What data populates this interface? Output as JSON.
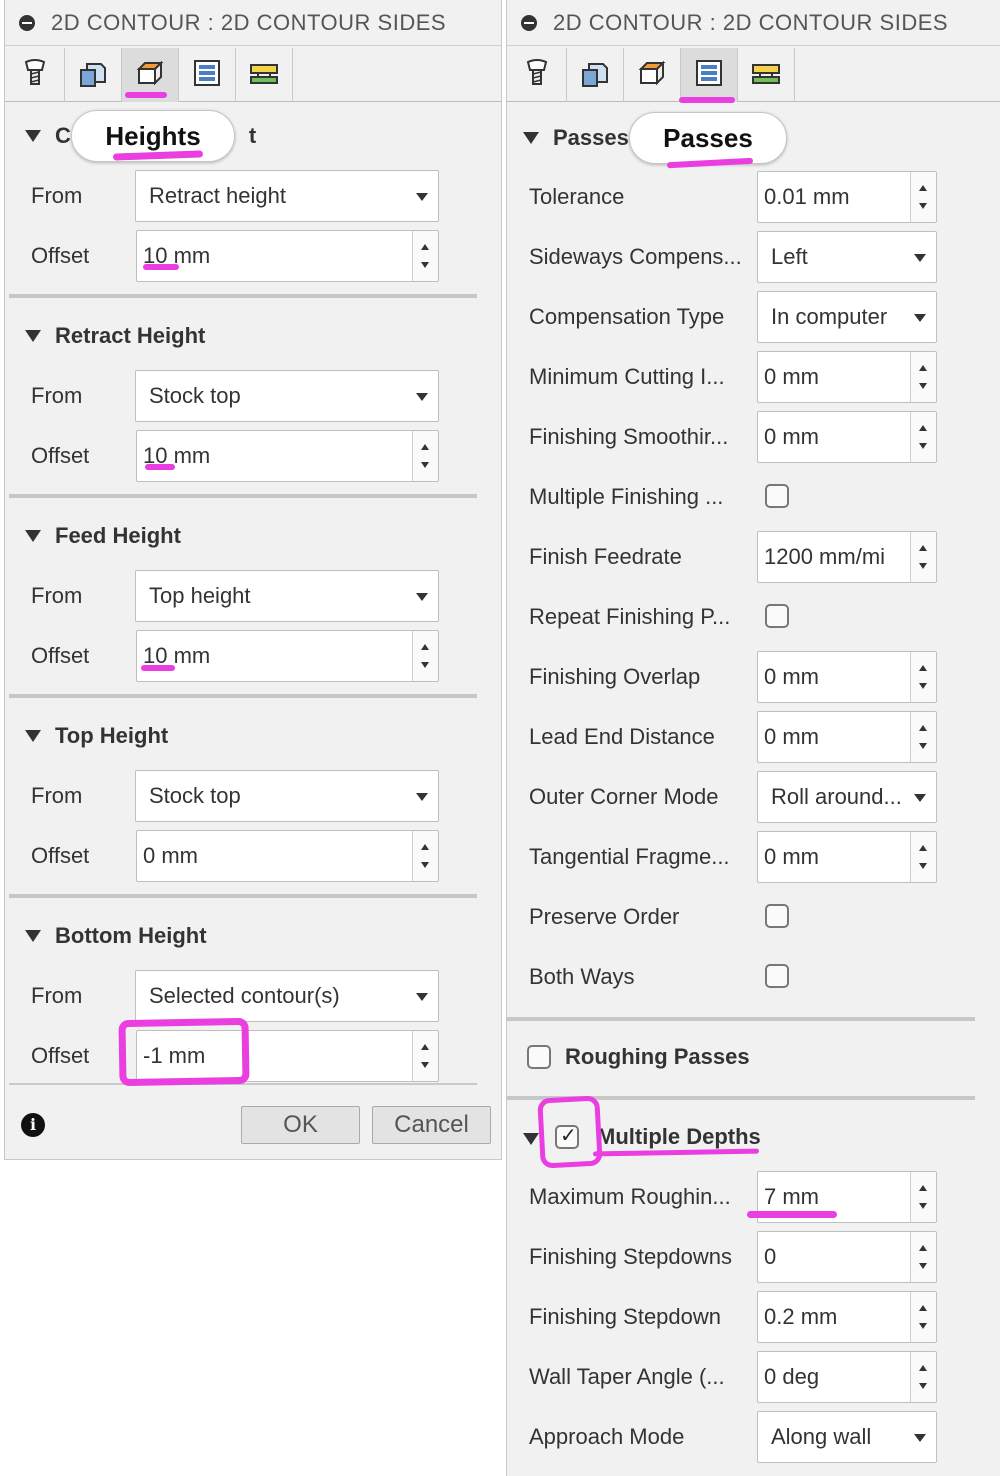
{
  "left": {
    "title": "2D CONTOUR : 2D CONTOUR SIDES",
    "tabs": [
      {
        "icon": "tool-icon"
      },
      {
        "icon": "geometry-icon"
      },
      {
        "icon": "heights-icon",
        "active": true
      },
      {
        "icon": "passes-icon"
      },
      {
        "icon": "linking-icon"
      }
    ],
    "tooltip": "Heights",
    "header_fragments": {
      "prefix": "C",
      "suffix": "t"
    },
    "sections": [
      {
        "title": "",
        "from_label": "From",
        "from_value": "Retract height",
        "offset_label": "Offset",
        "offset_value": "10 mm"
      },
      {
        "title": "Retract Height",
        "from_label": "From",
        "from_value": "Stock top",
        "offset_label": "Offset",
        "offset_value": "10 mm"
      },
      {
        "title": "Feed Height",
        "from_label": "From",
        "from_value": "Top height",
        "offset_label": "Offset",
        "offset_value": "10 mm"
      },
      {
        "title": "Top Height",
        "from_label": "From",
        "from_value": "Stock top",
        "offset_label": "Offset",
        "offset_value": "0 mm"
      },
      {
        "title": "Bottom Height",
        "from_label": "From",
        "from_value": "Selected contour(s)",
        "offset_label": "Offset",
        "offset_value": "-1 mm"
      }
    ],
    "ok_label": "OK",
    "cancel_label": "Cancel"
  },
  "right": {
    "title": "2D CONTOUR : 2D CONTOUR SIDES",
    "tabs": [
      {
        "icon": "tool-icon"
      },
      {
        "icon": "geometry-icon"
      },
      {
        "icon": "heights-icon"
      },
      {
        "icon": "passes-icon",
        "active": true
      },
      {
        "icon": "linking-icon"
      }
    ],
    "tooltip": "Passes",
    "section_title": "Passes",
    "rows": [
      {
        "label": "Tolerance",
        "type": "spinner",
        "value": "0.01 mm"
      },
      {
        "label": "Sideways Compens...",
        "type": "select",
        "value": "Left"
      },
      {
        "label": "Compensation Type",
        "type": "select",
        "value": "In computer"
      },
      {
        "label": "Minimum Cutting I...",
        "type": "spinner",
        "value": "0 mm"
      },
      {
        "label": "Finishing Smoothir...",
        "type": "spinner",
        "value": "0 mm"
      },
      {
        "label": "Multiple Finishing ...",
        "type": "checkbox",
        "checked": false
      },
      {
        "label": "Finish Feedrate",
        "type": "spinner",
        "value": "1200 mm/mi"
      },
      {
        "label": "Repeat Finishing P...",
        "type": "checkbox",
        "checked": false
      },
      {
        "label": "Finishing Overlap",
        "type": "spinner",
        "value": "0 mm"
      },
      {
        "label": "Lead End Distance",
        "type": "spinner",
        "value": "0 mm"
      },
      {
        "label": "Outer Corner Mode",
        "type": "select",
        "value": "Roll around..."
      },
      {
        "label": "Tangential Fragme...",
        "type": "spinner",
        "value": "0 mm"
      },
      {
        "label": "Preserve Order",
        "type": "checkbox",
        "checked": false
      },
      {
        "label": "Both Ways",
        "type": "checkbox",
        "checked": false
      }
    ],
    "roughing_passes": {
      "label": "Roughing Passes",
      "checked": false
    },
    "multiple_depths": {
      "label": "Multiple Depths",
      "label_visible": "Multiple Depths",
      "checked": true
    },
    "depth_rows": [
      {
        "label": "Maximum Roughin...",
        "type": "spinner",
        "value": "7 mm"
      },
      {
        "label": "Finishing Stepdowns",
        "type": "spinner",
        "value": "0"
      },
      {
        "label": "Finishing Stepdown",
        "type": "spinner",
        "value": "0.2 mm"
      },
      {
        "label": "Wall Taper Angle (...",
        "type": "spinner",
        "value": "0 deg"
      },
      {
        "label": "Approach Mode",
        "type": "select",
        "value": "Along wall"
      }
    ]
  },
  "colors": {
    "annotation": "#ea3ee0",
    "panel": "#f1f1f1"
  }
}
